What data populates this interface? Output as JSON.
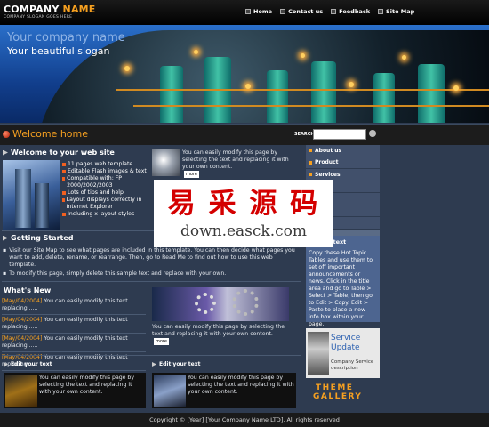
{
  "header": {
    "logo_company": "COMPANY",
    "logo_name": "NAME",
    "slogan_small": "COMPANY SLOGAN GOES HERE",
    "nav": [
      "Home",
      "Contact us",
      "Feedback",
      "Site Map"
    ]
  },
  "banner": {
    "company": "Your company name",
    "slogan": "Your beautiful slogan"
  },
  "welcome_bar": {
    "title": "Welcome home",
    "search_label": "SEARCH",
    "search_value": ""
  },
  "welcome_section": {
    "heading": "Welcome to your web site",
    "bullets": [
      "11 pages web template",
      "Editable Flash images & text",
      "Compatible with: FP 2000/2002/2003",
      "Lots of tips and help",
      "Layout displays correctly in Internet Explorer",
      "Including x layout styles"
    ],
    "side_text": "You can easily modify this page by selecting the text and replacing it with your own content.",
    "more": "more"
  },
  "getting_started": {
    "heading": "Getting Started",
    "p1": "Visit our Site Map to see what pages are included in this template. You can then decide what pages you want to add, delete, rename, or rearrange. Then, go to Read Me to find out how to use this web template.",
    "p2": "To modify this page, simply delete this sample text and replace with your own."
  },
  "whats_new": {
    "heading": "What's New",
    "items": [
      {
        "date": "[May/04/2004]",
        "text": "You can easily modify this text replacing......"
      },
      {
        "date": "[May/04/2004]",
        "text": "You can easily modify this text replacing......"
      },
      {
        "date": "[May/04/2004]",
        "text": "You can easily modify this text replacing......"
      },
      {
        "date": "[May/04/2004]",
        "text": "You can easily modify this text replacing......"
      }
    ],
    "side_text": "You can easily modify this page by selecting the text and replacing it with your own content.",
    "more": "more"
  },
  "edit_boxes": [
    {
      "heading": "Edit your text",
      "text": "You can easily modify this page by selecting the text and replacing it with your own content."
    },
    {
      "heading": "Edit your text",
      "text": "You can easily modify this page by selecting the text and replacing it with your own content."
    }
  ],
  "sidebar": {
    "items": [
      "About us",
      "Product",
      "Services",
      "",
      "",
      "",
      ""
    ]
  },
  "hot_topic": {
    "heading": "r text",
    "text": "Copy these Hot Topic Tables and use them to set off important announcements or news. Click in the title area and go to Table > Select > Table, then go to Edit > Copy. Edit > Paste to place a new info box within your page."
  },
  "service": {
    "title1": "Service",
    "title2": "Update",
    "desc": "Company Service description"
  },
  "gallery": {
    "line1": "THEME",
    "line2": "GALLERY"
  },
  "watermark": {
    "line1": "易 采 源 码",
    "line2": "down.easck.com"
  },
  "footer": "Copyright © [Year] [Your Company Name LTD]. All rights reserved",
  "colors": {
    "accent": "#f6a020",
    "background": "#2e3b50",
    "sidebar": "#41506b"
  }
}
